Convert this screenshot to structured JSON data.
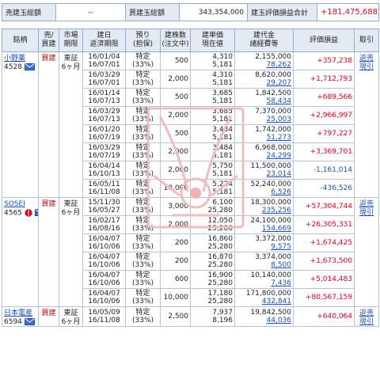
{
  "summary": {
    "sell_label": "売建玉総額",
    "sell_value": "--",
    "buy_label": "買建玉総額",
    "buy_value": "343,354,000",
    "pl_label": "建玉評価損益合計",
    "pl_value": "+181,475,688"
  },
  "headers": {
    "name": "銘柄",
    "side": [
      "売/",
      "買建"
    ],
    "market": [
      "市場",
      "期限"
    ],
    "date": [
      "建日",
      "返済期限"
    ],
    "kind": [
      "預り",
      "(担保)"
    ],
    "qty": [
      "建株数",
      "(注文中)"
    ],
    "price": [
      "建単価",
      "現在値"
    ],
    "amount": [
      "建代金",
      "諸経費等"
    ],
    "pl": "評価損益",
    "action": "取引"
  },
  "groups": [
    {
      "name": "小野薬",
      "code": "4528",
      "side": "買建",
      "market": "東証",
      "term": "6ヶ月",
      "alert": false,
      "action": [
        "返売",
        "現引"
      ],
      "rows": [
        {
          "d1": "16/01/04",
          "d2": "16/07/01",
          "k1": "特定",
          "k2": "(33%)",
          "qty": "500",
          "p1": "4,310",
          "p2": "5,181",
          "a1": "2,155,000",
          "a2": "78,262",
          "pl": "+357,238"
        },
        {
          "d1": "16/03/29",
          "d2": "16/07/01",
          "k1": "特定",
          "k2": "(33%)",
          "qty": "2,000",
          "p1": "4,310",
          "p2": "5,181",
          "a1": "8,620,000",
          "a2": "29,207",
          "pl": "+1,712,793"
        },
        {
          "d1": "16/01/14",
          "d2": "16/07/13",
          "k1": "特定",
          "k2": "(33%)",
          "qty": "500",
          "p1": "3,685",
          "p2": "5,181",
          "a1": "1,842,500",
          "a2": "58,434",
          "pl": "+689,566"
        },
        {
          "d1": "16/03/29",
          "d2": "16/07/13",
          "k1": "特定",
          "k2": "(33%)",
          "qty": "2,000",
          "p1": "3,685",
          "p2": "5,181",
          "a1": "7,370,000",
          "a2": "25,003",
          "pl": "+2,966,997"
        },
        {
          "d1": "16/01/20",
          "d2": "16/07/19",
          "k1": "特定",
          "k2": "(33%)",
          "qty": "500",
          "p1": "3,484",
          "p2": "5,181",
          "a1": "1,742,000",
          "a2": "51,273",
          "pl": "+797,227"
        },
        {
          "d1": "16/03/29",
          "d2": "16/07/19",
          "k1": "特定",
          "k2": "(33%)",
          "qty": "2,000",
          "p1": "3,484",
          "p2": "5,181",
          "a1": "6,968,000",
          "a2": "24,299",
          "pl": "+3,369,701"
        },
        {
          "d1": "16/04/14",
          "d2": "16/10/13",
          "k1": "特定",
          "k2": "(33%)",
          "qty": "2,000",
          "p1": "5,750",
          "p2": "5,181",
          "a1": "11,500,000",
          "a2": "23,014",
          "pl": "-1,161,014"
        },
        {
          "d1": "16/05/11",
          "d2": "16/11/08",
          "k1": "特定",
          "k2": "(33%)",
          "qty": "10,000",
          "p1": "5,224",
          "p2": "5,181",
          "a1": "52,240,000",
          "a2": "6,526",
          "pl": "-436,526"
        }
      ]
    },
    {
      "name": "SOSEI",
      "code": "4565",
      "side": "買建",
      "market": "東証",
      "term": "6ヶ月",
      "alert": true,
      "action": [
        "返売",
        "現引"
      ],
      "rows": [
        {
          "d1": "15/11/30",
          "d2": "16/05/27",
          "k1": "特定",
          "k2": "(33%)",
          "qty": "3,000",
          "p1": "6,100",
          "p2": "25,280",
          "a1": "18,300,000",
          "a2": "235,256",
          "pl": "+57,304,744"
        },
        {
          "d1": "16/02/17",
          "d2": "16/08/16",
          "k1": "特定",
          "k2": "(33%)",
          "qty": "2,000",
          "p1": "12,050",
          "p2": "25,280",
          "a1": "24,100,000",
          "a2": "154,669",
          "pl": "+26,305,331"
        },
        {
          "d1": "16/04/07",
          "d2": "16/10/06",
          "k1": "特定",
          "k2": "(33%)",
          "qty": "200",
          "p1": "16,860",
          "p2": "25,280",
          "a1": "3,372,000",
          "a2": "9,575",
          "pl": "+1,674,425"
        },
        {
          "d1": "16/04/07",
          "d2": "16/10/06",
          "k1": "特定",
          "k2": "(33%)",
          "qty": "200",
          "p1": "16,870",
          "p2": "25,280",
          "a1": "3,374,000",
          "a2": "8,500",
          "pl": "+1,673,500"
        },
        {
          "d1": "16/04/07",
          "d2": "16/10/06",
          "k1": "特定",
          "k2": "(33%)",
          "qty": "600",
          "p1": "16,900",
          "p2": "25,280",
          "a1": "10,140,000",
          "a2": "7,436",
          "pl": "+5,014,483"
        },
        {
          "d1": "16/04/07",
          "d2": "16/10/06",
          "k1": "特定",
          "k2": "(33%)",
          "qty": "10,000",
          "p1": "17,180",
          "p2": "25,280",
          "a1": "171,800,000",
          "a2": "432,841",
          "pl": "+80,567,159"
        }
      ]
    },
    {
      "name": "日本電産",
      "code": "6594",
      "side": "買建",
      "market": "東証",
      "term": "6ヶ月",
      "alert": false,
      "action": [
        "返売",
        "現引"
      ],
      "rows": [
        {
          "d1": "16/05/09",
          "d2": "16/11/08",
          "k1": "特定",
          "k2": "(33%)",
          "qty": "2,500",
          "p1": "7,937",
          "p2": "8,196",
          "a1": "19,842,500",
          "a2": "44,036",
          "pl": "+640,064"
        }
      ]
    }
  ]
}
